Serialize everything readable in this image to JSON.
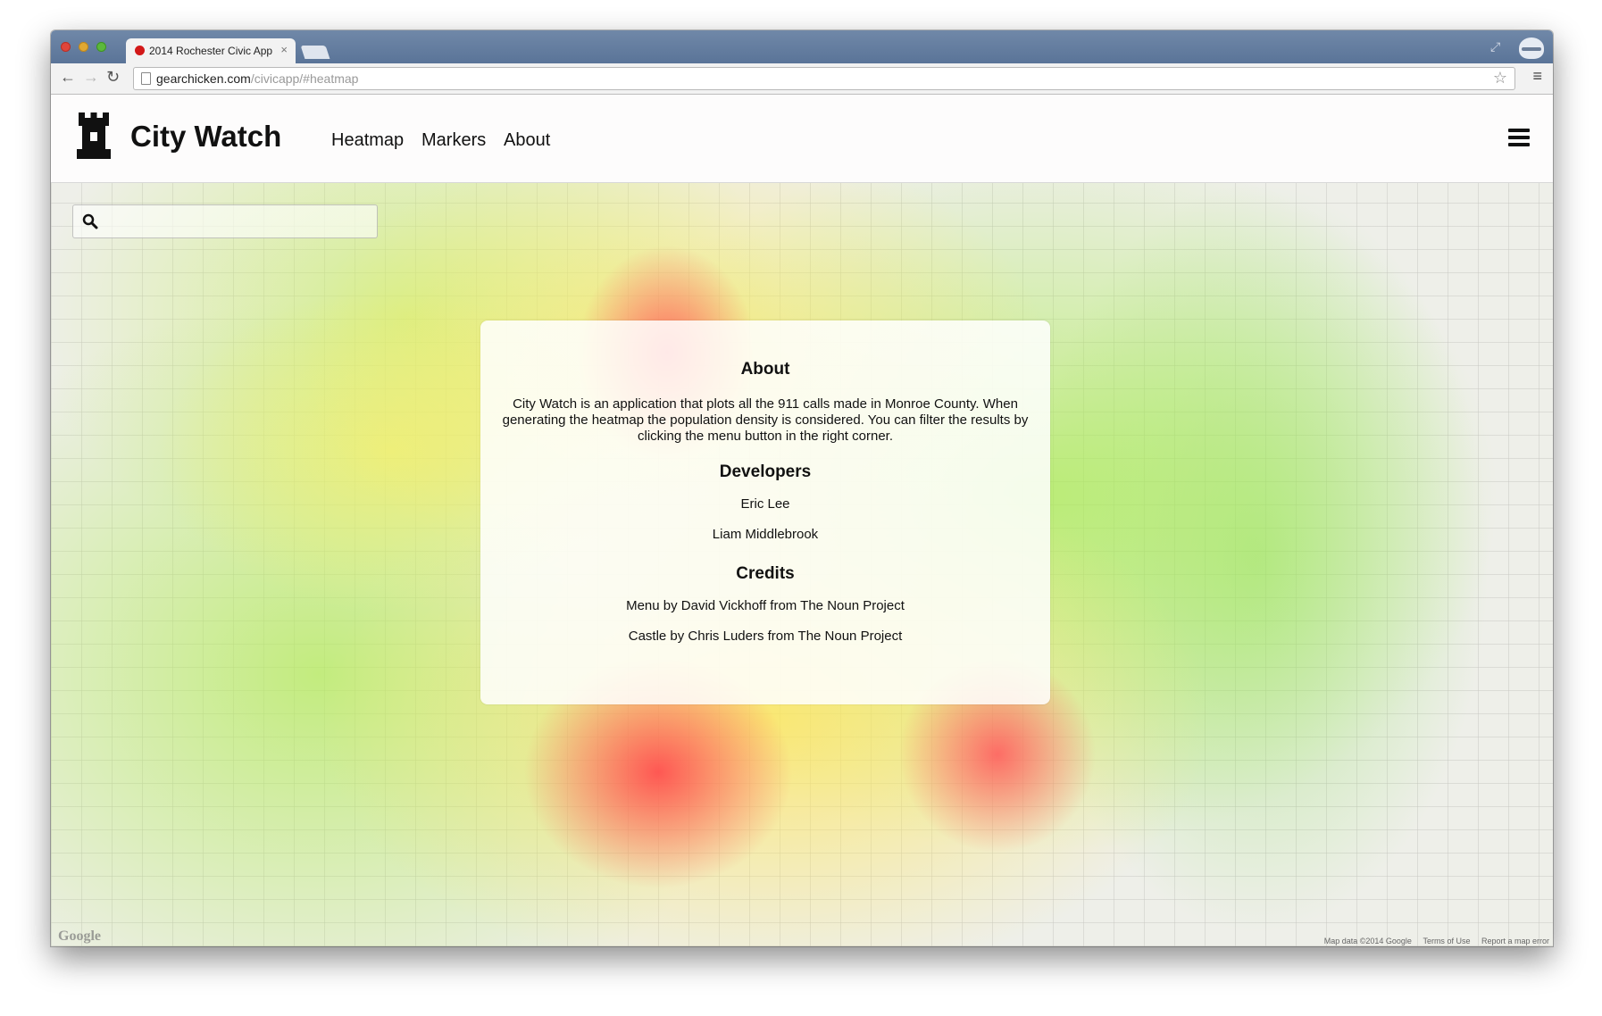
{
  "browser": {
    "tab_title": "2014 Rochester Civic App",
    "tab_close": "×",
    "url_host": "gearchicken.com",
    "url_path": "/civicapp/#heatmap"
  },
  "header": {
    "brand": "City Watch",
    "nav": [
      "Heatmap",
      "Markers",
      "About"
    ]
  },
  "map": {
    "search_value": "",
    "attribution_logo": "Google",
    "footer": [
      "Map data ©2014 Google",
      "Terms of Use",
      "Report a map error"
    ]
  },
  "about": {
    "title": "About",
    "description": "City Watch is an application that plots all the 911 calls made in Monroe County. When generating the heatmap the population density is considered. You can filter the results by clicking the menu button in the right corner.",
    "developers_title": "Developers",
    "developers": [
      "Eric Lee",
      "Liam Middlebrook"
    ],
    "credits_title": "Credits",
    "credits": [
      "Menu by David Vickhoff from The Noun Project",
      "Castle by Chris Luders from The Noun Project"
    ]
  },
  "colors": {
    "heat_high": "#ff5f5f",
    "heat_mid": "#ffe65a",
    "heat_low": "#aaeb50",
    "tabbar": "#6480a4"
  },
  "icons": [
    "castle-icon",
    "hamburger-icon",
    "search-icon",
    "star-icon",
    "reload-icon",
    "back-icon",
    "forward-icon",
    "incognito-icon"
  ]
}
